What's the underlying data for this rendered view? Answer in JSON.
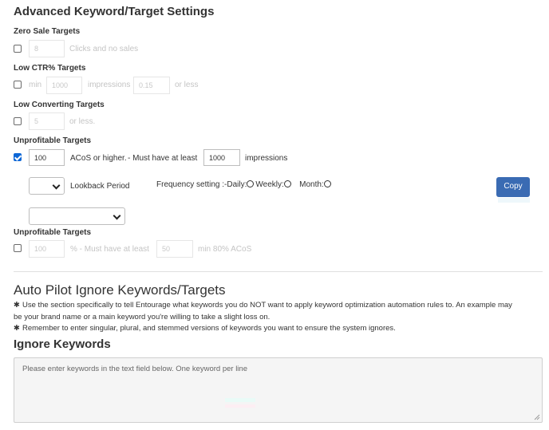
{
  "page_title": "Advanced Keyword/Target Settings",
  "zero_sale": {
    "label": "Zero Sale Targets",
    "clicks_value": "8",
    "clicks_text": "Clicks and no sales"
  },
  "low_ctr": {
    "label": "Low CTR% Targets",
    "min_text": "min",
    "impressions_value": "1000",
    "impressions_text": "impressions",
    "ctr_value": "0.15",
    "or_less_text": "or less"
  },
  "low_converting": {
    "label": "Low Converting Targets",
    "value": "5",
    "or_less_text": "or less."
  },
  "unprofitable": {
    "label": "Unprofitable Targets",
    "acos_value": "100",
    "acos_text": "ACoS or higher.",
    "must_text": "-  Must have at least",
    "impressions_value": "1000",
    "impressions_text": "impressions",
    "lookback_label": "Lookback Period",
    "frequency_label": "Frequency setting :-",
    "daily_label": "Daily:",
    "weekly_label": "Weekly:",
    "month_label": "Month:",
    "copy_label": "Copy"
  },
  "unprofitable2": {
    "label": "Unprofitable Targets",
    "pct_value": "100",
    "pct_text": "%  -  Must have at least",
    "min_value": "50",
    "min_text": "min 80% ACoS"
  },
  "auto_pilot": {
    "title": "Auto Pilot Ignore Keywords/Targets",
    "note1_line1": "Use the section specifically to tell Entourage what keywords you do NOT want to apply keyword optimization automation rules to. An example may",
    "note1_line2": "be your brand name or a main keyword you're willing to take a slight loss on.",
    "note2": "Remember to enter singular, plural, and stemmed versions of keywords you want to ensure the system ignores."
  },
  "ignore": {
    "title": "Ignore Keywords",
    "placeholder": "Please enter keywords in the text field below. One keyword per line"
  },
  "colors": {
    "checkbox_checked": "#0d67d6",
    "copy_button": "#3a6bb3"
  }
}
